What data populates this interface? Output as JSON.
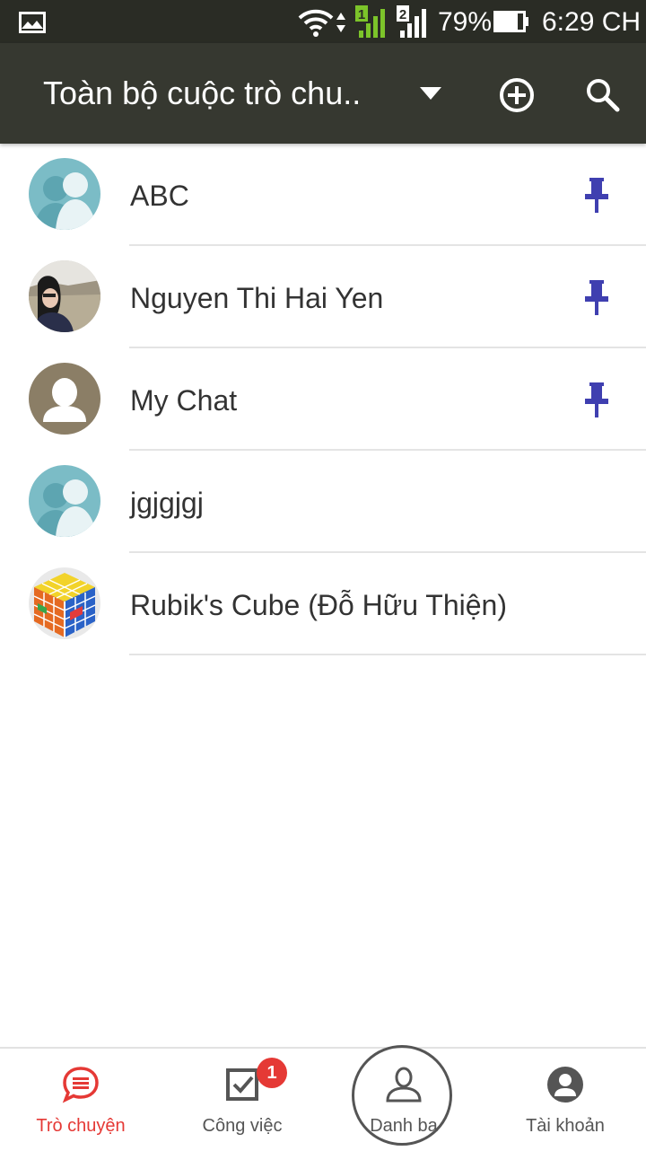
{
  "status_bar": {
    "battery": "79%",
    "time": "6:29 CH",
    "sim1_label": "1",
    "sim2_label": "2"
  },
  "app_bar": {
    "title": "Toàn bộ cuộc trò chu..",
    "icons": [
      "dropdown-icon",
      "add-circle-icon",
      "search-icon"
    ]
  },
  "conversations": [
    {
      "name": "ABC",
      "avatar": "group-avatar",
      "pinned": true
    },
    {
      "name": "Nguyen Thi Hai Yen",
      "avatar": "photo-avatar",
      "pinned": true
    },
    {
      "name": "My Chat",
      "avatar": "person-avatar",
      "pinned": true
    },
    {
      "name": "jgjgjgj",
      "avatar": "group-avatar",
      "pinned": false
    },
    {
      "name": "Rubik's Cube (Đỗ Hữu Thiện)",
      "avatar": "rubik-avatar",
      "pinned": false
    }
  ],
  "bottom_nav": [
    {
      "label": "Trò chuyện",
      "icon": "chat-icon",
      "active": true
    },
    {
      "label": "Công việc",
      "icon": "task-icon",
      "badge": "1"
    },
    {
      "label": "Danh bạ",
      "icon": "contacts-icon"
    },
    {
      "label": "Tài khoản",
      "icon": "account-icon"
    }
  ],
  "colors": {
    "app_bar": "#363830",
    "status_bar": "#2a2c25",
    "accent": "#e53935",
    "pin": "#3f3fb0",
    "group_avatar": "#7bbcc6",
    "person_avatar": "#8b7e66"
  }
}
